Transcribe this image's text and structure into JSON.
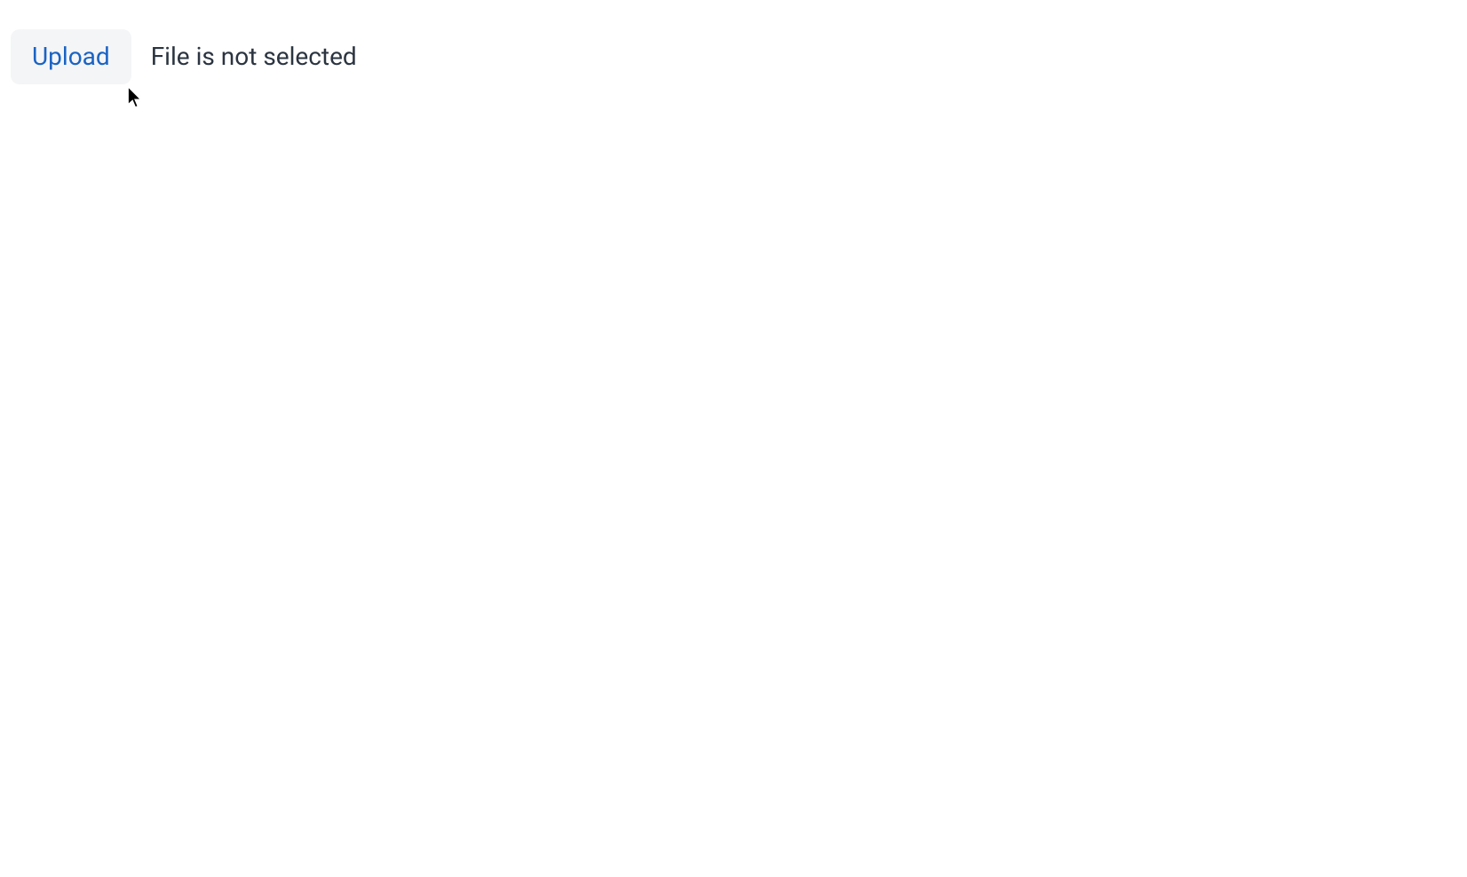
{
  "upload": {
    "button_label": "Upload",
    "status_text": "File is not selected"
  }
}
